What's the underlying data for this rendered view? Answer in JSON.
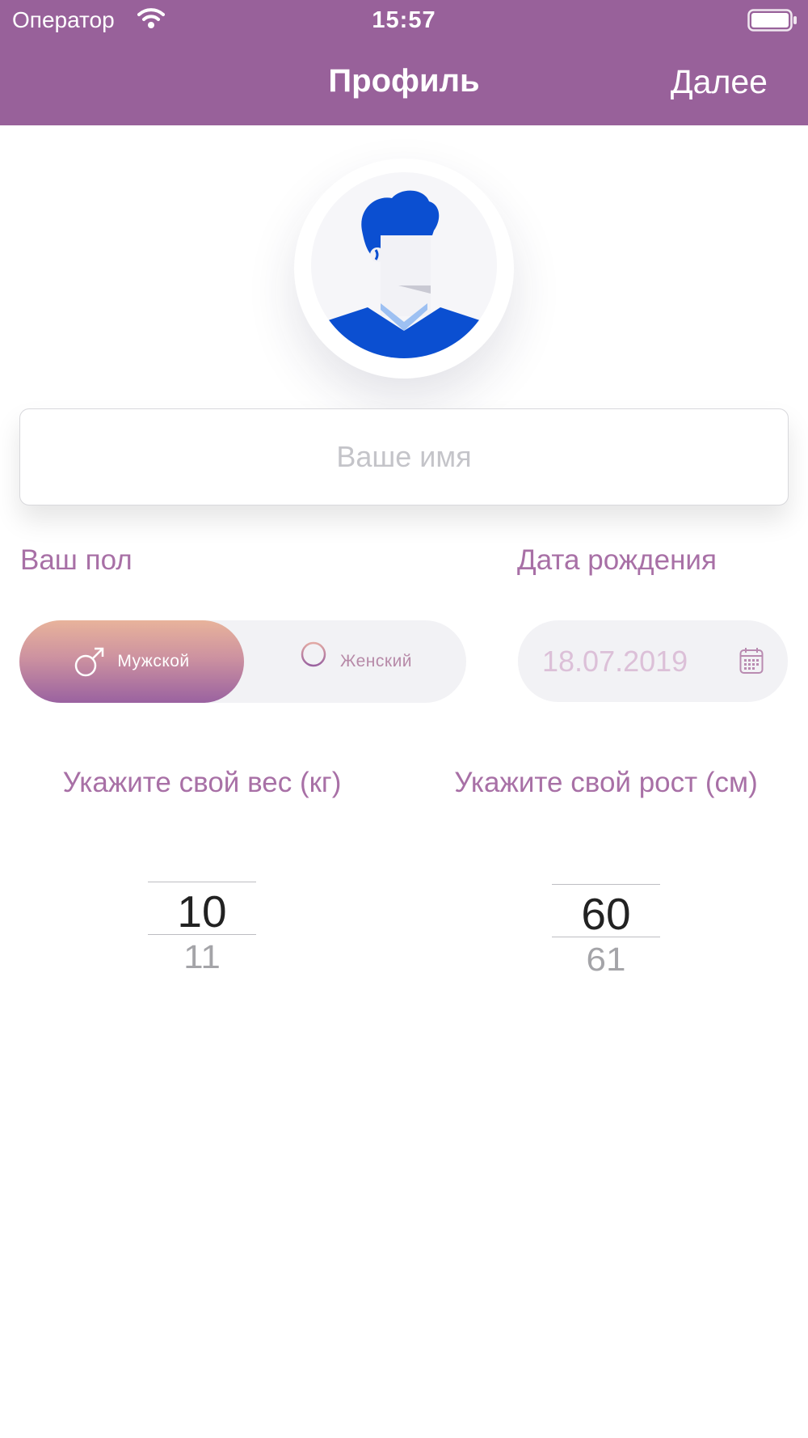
{
  "status_bar": {
    "carrier": "Оператор",
    "time": "15:57"
  },
  "nav": {
    "title": "Профиль",
    "next_label": "Далее"
  },
  "profile": {
    "name_placeholder": "Ваше имя",
    "name_value": ""
  },
  "gender": {
    "label": "Ваш пол",
    "selected": "male",
    "male_label": "Мужской",
    "female_label": "Женский"
  },
  "birth": {
    "label": "Дата рождения",
    "value": "18.07.2019"
  },
  "weight": {
    "label": "Укажите свой вес (кг)",
    "value": "10",
    "next_value": "11"
  },
  "height": {
    "label": "Укажите свой рост (см)",
    "value": "60",
    "next_value": "61"
  },
  "colors": {
    "header": "#98619a",
    "label": "#a870a6",
    "gender_gradient": [
      "#e8b39b",
      "#9a62a0"
    ],
    "avatar_blue": "#0b4fd1"
  },
  "icons": {
    "wifi": "wifi-icon",
    "battery": "battery-icon",
    "male": "male-symbol-icon",
    "female": "female-symbol-icon",
    "calendar": "calendar-icon"
  }
}
